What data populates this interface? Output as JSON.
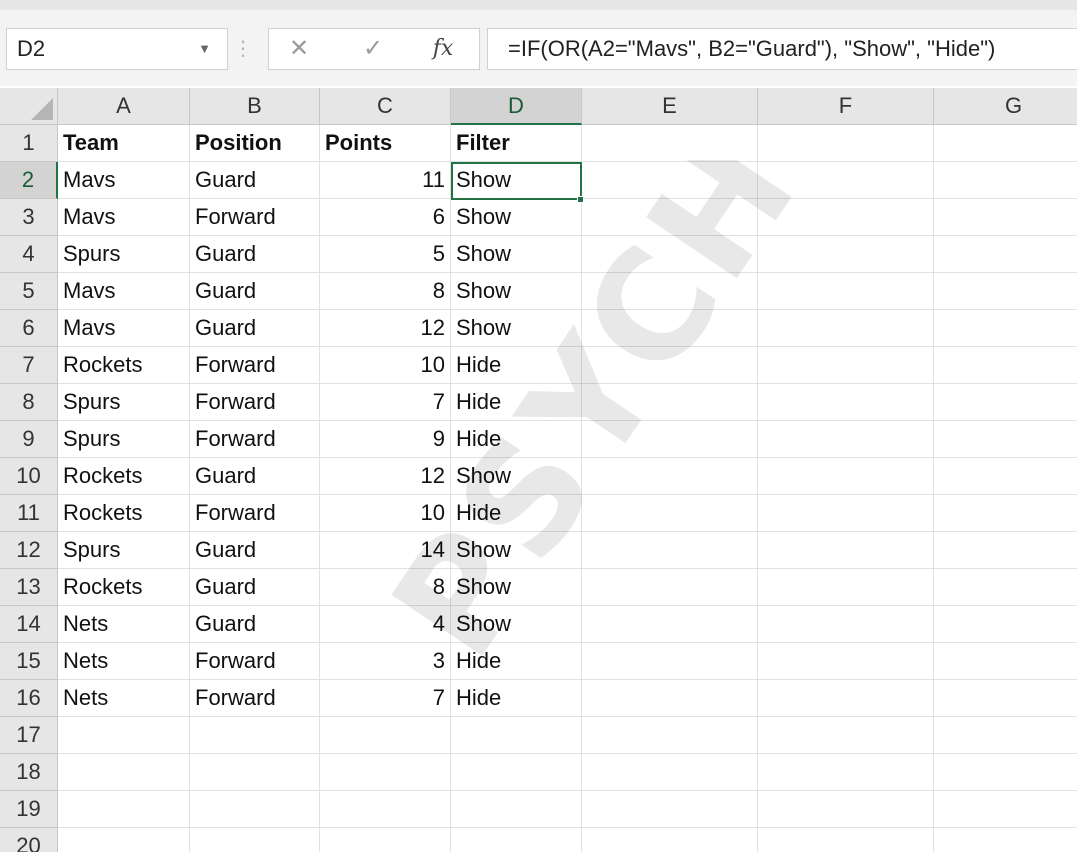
{
  "formula_bar": {
    "name_box": "D2",
    "cancel_glyph": "✕",
    "enter_glyph": "✓",
    "fx_label": "fx",
    "formula": "=IF(OR(A2=\"Mavs\", B2=\"Guard\"), \"Show\", \"Hide\")"
  },
  "sheet": {
    "columns": [
      "A",
      "B",
      "C",
      "D",
      "E",
      "F",
      "G"
    ],
    "row_numbers": [
      "1",
      "2",
      "3",
      "4",
      "5",
      "6",
      "7",
      "8",
      "9",
      "10",
      "11",
      "12",
      "13",
      "14",
      "15",
      "16",
      "17",
      "18",
      "19",
      "20"
    ],
    "selected_cell": "D2",
    "header_row": [
      "Team",
      "Position",
      "Points",
      "Filter"
    ],
    "rows": [
      [
        "Mavs",
        "Guard",
        "11",
        "Show"
      ],
      [
        "Mavs",
        "Forward",
        "6",
        "Show"
      ],
      [
        "Spurs",
        "Guard",
        "5",
        "Show"
      ],
      [
        "Mavs",
        "Guard",
        "8",
        "Show"
      ],
      [
        "Mavs",
        "Guard",
        "12",
        "Show"
      ],
      [
        "Rockets",
        "Forward",
        "10",
        "Hide"
      ],
      [
        "Spurs",
        "Forward",
        "7",
        "Hide"
      ],
      [
        "Spurs",
        "Forward",
        "9",
        "Hide"
      ],
      [
        "Rockets",
        "Guard",
        "12",
        "Show"
      ],
      [
        "Rockets",
        "Forward",
        "10",
        "Hide"
      ],
      [
        "Spurs",
        "Guard",
        "14",
        "Show"
      ],
      [
        "Rockets",
        "Guard",
        "8",
        "Show"
      ],
      [
        "Nets",
        "Guard",
        "4",
        "Show"
      ],
      [
        "Nets",
        "Forward",
        "3",
        "Hide"
      ],
      [
        "Nets",
        "Forward",
        "7",
        "Hide"
      ]
    ]
  },
  "watermark": "PSYCHOLOGY.CO",
  "colors": {
    "accent": "#217346",
    "header_bg": "#e6e6e6",
    "selected_header_bg": "#d3d3d3"
  }
}
